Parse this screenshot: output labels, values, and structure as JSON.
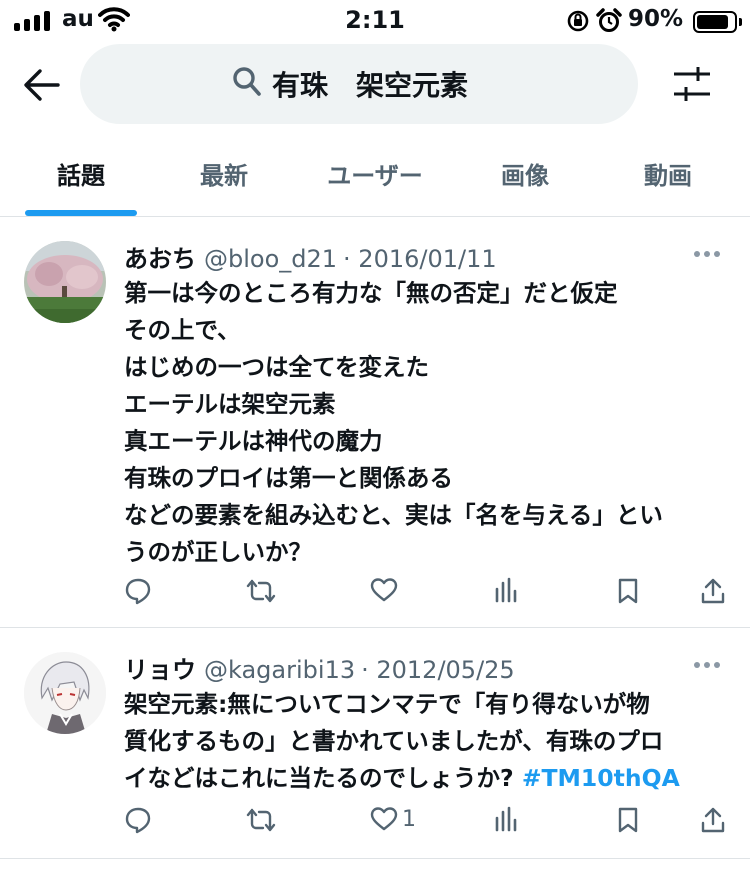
{
  "status_bar": {
    "carrier": "au",
    "time": "2:11",
    "battery_percent": "90%",
    "battery_level": 0.9
  },
  "search": {
    "query": "有珠　架空元素",
    "icons": [
      "back-arrow-icon",
      "search-icon",
      "filter-sliders-icon"
    ]
  },
  "tabs": [
    {
      "label": "話題",
      "active": true
    },
    {
      "label": "最新",
      "active": false
    },
    {
      "label": "ユーザー",
      "active": false
    },
    {
      "label": "画像",
      "active": false
    },
    {
      "label": "動画",
      "active": false
    }
  ],
  "tweets": [
    {
      "name": "あおち",
      "handle": "@bloo_d21",
      "date": "· 2016/01/11",
      "lines": [
        "第一は今のところ有力な「無の否定」だと仮定",
        "その上で、",
        "はじめの一つは全てを変えた",
        "エーテルは架空元素",
        "真エーテルは神代の魔力",
        "有珠のプロイは第一と関係ある",
        "などの要素を組み込むと、実は「名を与える」とい",
        "うのが正しいか？"
      ],
      "likes": ""
    },
    {
      "name": "リョウ",
      "handle": "@kagaribi13",
      "date": "· 2012/05/25",
      "lines": [
        "架空元素:無についてコンマテで「有り得ないが物",
        "質化するもの」と書かれていましたが、有珠のプロ"
      ],
      "last_line_text": "イなどはこれに当たるのでしょうか? ",
      "hashtag": "#TM10thQA",
      "likes": "1"
    }
  ],
  "colors": {
    "accent": "#1d9bf0",
    "text": "#0f1419",
    "muted": "#536471",
    "search_bg": "#eff3f4"
  }
}
